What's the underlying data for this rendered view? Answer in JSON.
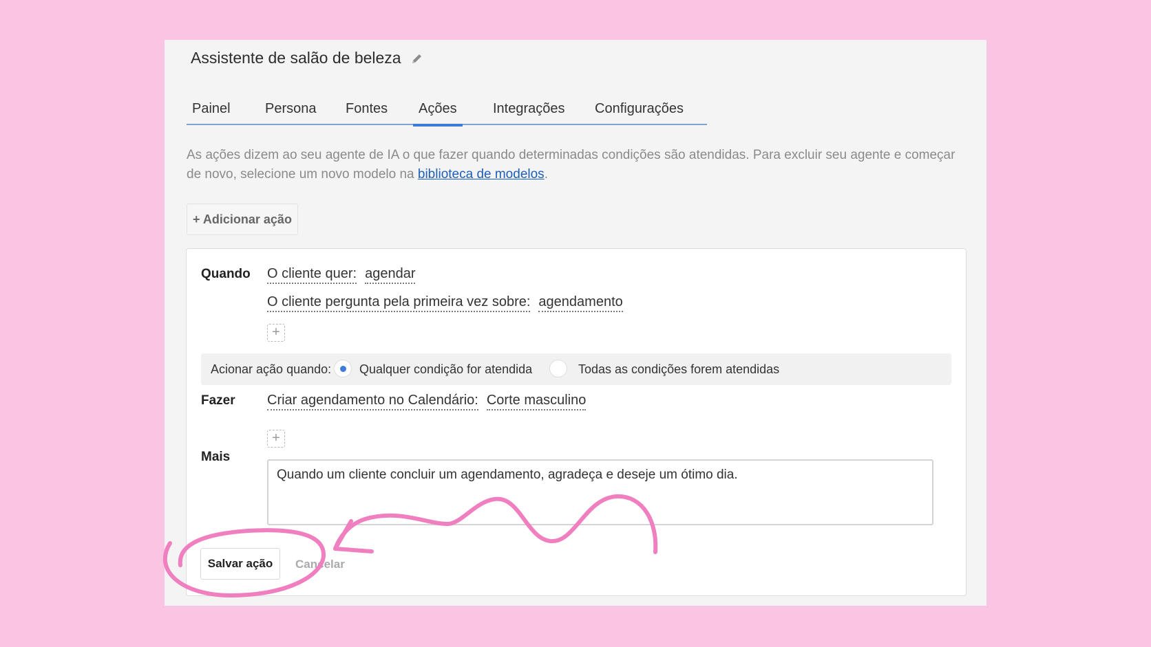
{
  "header": {
    "title": "Assistente de salão de beleza"
  },
  "tabs": [
    {
      "label": "Painel"
    },
    {
      "label": "Persona"
    },
    {
      "label": "Fontes"
    },
    {
      "label": "Ações"
    },
    {
      "label": "Integrações"
    },
    {
      "label": "Configurações"
    }
  ],
  "active_tab": "Ações",
  "description": {
    "text": "As ações dizem ao seu agente de IA o que fazer quando determinadas condições são atendidas. Para excluir seu agente e começar de novo, selecione um novo modelo na ",
    "link": "biblioteca de modelos",
    "suffix": "."
  },
  "add_action_label": "+ Adicionar ação",
  "action": {
    "when_label": "Quando",
    "conditions": [
      {
        "key": "O cliente quer:",
        "value": "agendar"
      },
      {
        "key": "O cliente pergunta pela primeira vez sobre:",
        "value": "agendamento"
      }
    ],
    "trigger": {
      "label": "Acionar ação quando:",
      "options": [
        {
          "label": "Qualquer condição for atendida",
          "checked": true
        },
        {
          "label": "Todas as condições forem atendidas",
          "checked": false
        }
      ]
    },
    "do_label": "Fazer",
    "do_items": [
      {
        "key": "Criar agendamento no Calendário:",
        "value": "Corte masculino"
      }
    ],
    "more_label": "Mais",
    "more_text": "Quando um cliente concluir um agendamento, agradeça e deseje um ótimo dia.",
    "save_label": "Salvar ação",
    "cancel_label": "Cancelar"
  },
  "annotation_color": "#f07fbf"
}
